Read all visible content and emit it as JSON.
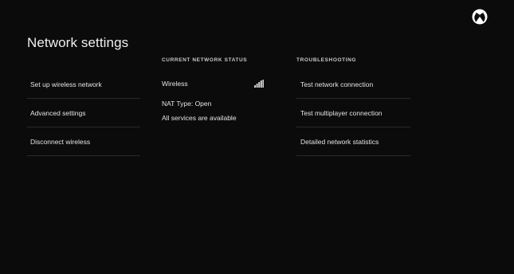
{
  "header": {
    "title": "Network settings",
    "logo_icon": "xbox-logo-icon"
  },
  "left_menu": {
    "items": [
      {
        "label": "Set up wireless network"
      },
      {
        "label": "Advanced settings"
      },
      {
        "label": "Disconnect wireless"
      }
    ]
  },
  "status": {
    "heading": "CURRENT NETWORK STATUS",
    "connection_type": "Wireless",
    "signal_icon": "wifi-signal-bars-icon",
    "nat_type": "NAT Type: Open",
    "services": "All services are available"
  },
  "troubleshooting": {
    "heading": "TROUBLESHOOTING",
    "items": [
      {
        "label": "Test network connection"
      },
      {
        "label": "Test multiplayer connection"
      },
      {
        "label": "Detailed network statistics"
      }
    ]
  },
  "colors": {
    "background": "#0b0b0b",
    "text": "#e4e4e4",
    "divider": "#2a2a2a"
  }
}
